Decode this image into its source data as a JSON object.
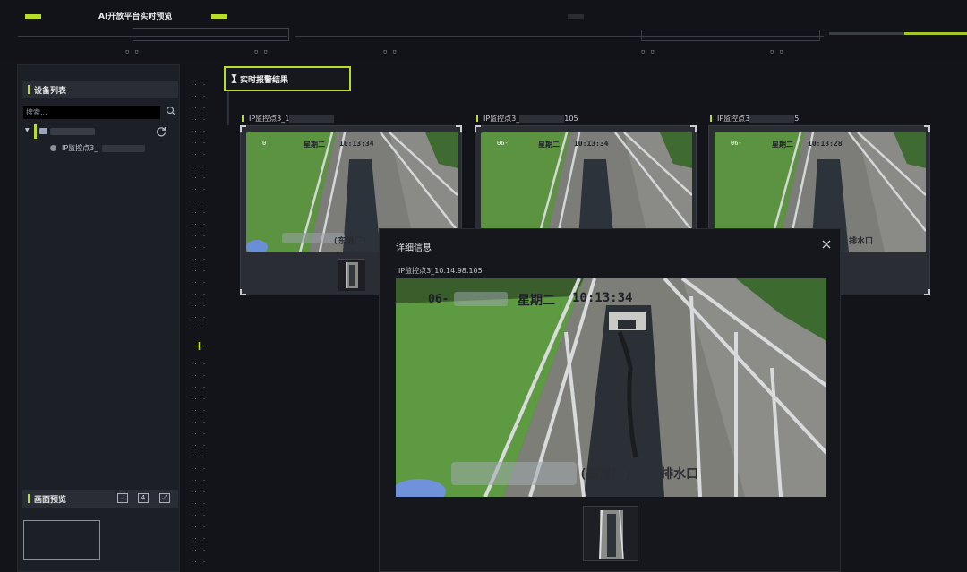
{
  "app": {
    "title": "AI开放平台实时预览"
  },
  "sidebar": {
    "device_list_label": "设备列表",
    "search_placeholder": "搜索...",
    "device_child_label": "IP监控点3_",
    "preview_label": "画面预览",
    "preview_layout_value": "4"
  },
  "results": {
    "header_label": "实时报警结果",
    "cards": [
      {
        "title": "IP监控点3_1",
        "timestamp": "0",
        "osd_day": "星期二",
        "osd_time": "10:13:34"
      },
      {
        "title": "IP监控点3_",
        "title_suffix": "105",
        "timestamp": "06-",
        "osd_day": "星期二",
        "osd_time": "10:13:34"
      },
      {
        "title": "IP监控点3",
        "title_suffix": "5",
        "timestamp": "06-",
        "osd_day": "星期二",
        "osd_time": "10:13:28"
      }
    ],
    "card1_caption": "(东港厂)",
    "card3_caption": "排水口"
  },
  "modal": {
    "title": "详细信息",
    "camera_label": "IP监控点3_10.14.98.105",
    "osd_date": "06-",
    "osd_day": "星期二",
    "osd_time": "10:13:34",
    "osd_caption_left": "(东港厂)",
    "osd_caption_right": "排水口"
  },
  "colors": {
    "accent": "#b7dd2a",
    "background": "#13141a",
    "panel": "#1d1f26"
  },
  "icons": [
    "search-icon",
    "refresh-icon",
    "close-icon",
    "folder-icon",
    "camera-dot-icon",
    "hourglass-icon",
    "split-icon",
    "fullscreen-icon"
  ]
}
